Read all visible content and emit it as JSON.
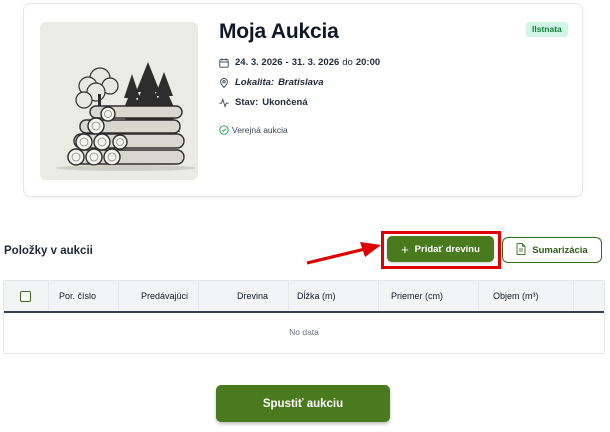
{
  "auction": {
    "title": "Moja Aukcia",
    "badge": "Ilstnata",
    "date_from": "24. 3. 2026",
    "date_to": "31. 3. 2026",
    "date_sep": "-",
    "date_connector": "do",
    "time": "20:00",
    "location_label": "Lokalita:",
    "location_value": "Bratislava",
    "state_label": "Stav:",
    "state_value": "Ukončená",
    "visibility": "Verejná aukcia"
  },
  "items_section": {
    "title": "Položky v aukcii",
    "add_button": "Pridať drevinu",
    "summary_button": "Sumarizácia"
  },
  "table": {
    "columns": [
      "Por. číslo",
      "Predávajúci",
      "Drevina",
      "Dĺžka (m)",
      "Priemer (cm)",
      "Objem (m³)"
    ],
    "empty_text": "No data"
  },
  "start_button": "Spustiť aukciu",
  "colors": {
    "primary": "#4a7a1e",
    "badge_bg": "#d1f5e4",
    "badge_text": "#15803d",
    "highlight": "#e00000"
  },
  "icons": {
    "date": "calendar-icon",
    "location": "map-pin-icon",
    "state": "activity-icon",
    "visibility": "check-circle-icon",
    "add": "plus-icon",
    "summary": "document-icon"
  }
}
